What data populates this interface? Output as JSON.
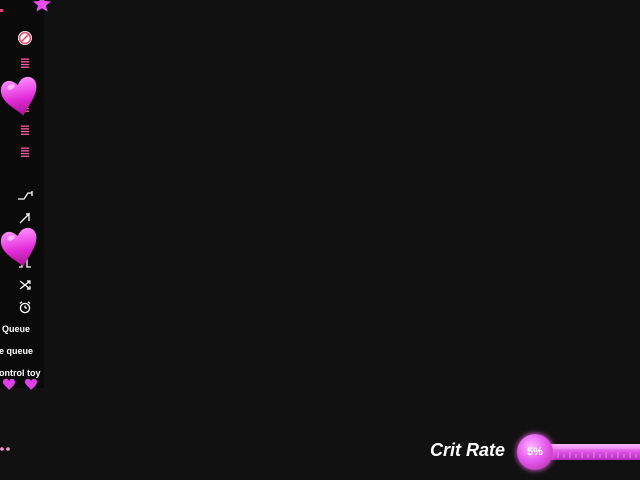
{
  "side_panel": {
    "buttons": [
      {
        "name": "stop-button",
        "icon": "prohibited-icon"
      },
      {
        "name": "list-button-1",
        "icon": "list-icon"
      },
      {
        "name": "list-button-2",
        "icon": "list-icon"
      },
      {
        "name": "list-button-3",
        "icon": "list-icon"
      },
      {
        "name": "list-button-4",
        "icon": "list-icon"
      },
      {
        "name": "list-button-5",
        "icon": "list-icon"
      },
      {
        "name": "pattern-step-button",
        "icon": "step-wave-icon"
      },
      {
        "name": "pattern-ramp-button",
        "icon": "ramp-wave-icon"
      },
      {
        "name": "pattern-wave-button",
        "icon": "sine-wave-icon"
      },
      {
        "name": "pattern-pulse-button",
        "icon": "pulse-wave-icon"
      },
      {
        "name": "shuffle-button",
        "icon": "shuffle-icon"
      },
      {
        "name": "alarm-button",
        "icon": "alarm-icon"
      }
    ],
    "queue_label": "Queue",
    "clear_queue_label": "e queue",
    "control_toy_label": "ontrol toy"
  },
  "crit": {
    "label": "Crit Rate",
    "value": "5%",
    "level_percent": 5
  },
  "colors": {
    "background": "#111112",
    "panel": "#0a0a0b",
    "accent": "#e040e8",
    "icon_pink": "#ff5aa5"
  }
}
